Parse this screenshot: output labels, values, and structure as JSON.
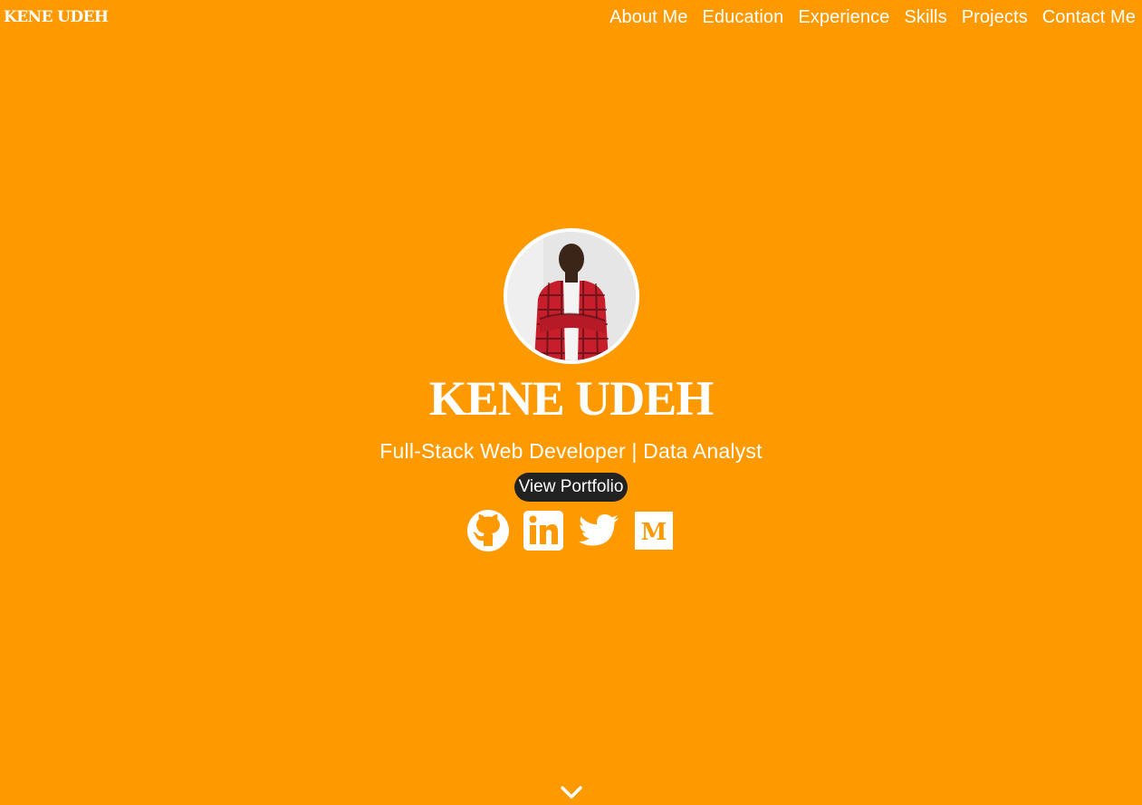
{
  "navbar": {
    "brand": "KENE UDEH",
    "links": [
      "About Me",
      "Education",
      "Experience",
      "Skills",
      "Projects",
      "Contact Me"
    ]
  },
  "hero": {
    "name": "KENE UDEH",
    "subtitle": "Full-Stack Web Developer | Data Analyst",
    "button_label": "View Portfolio",
    "socials": [
      {
        "icon": "github-icon"
      },
      {
        "icon": "linkedin-icon"
      },
      {
        "icon": "twitter-icon"
      },
      {
        "icon": "medium-icon",
        "glyph": "M"
      }
    ]
  },
  "colors": {
    "background": "#ff9900",
    "text": "#ffffff",
    "button": "#222222"
  }
}
